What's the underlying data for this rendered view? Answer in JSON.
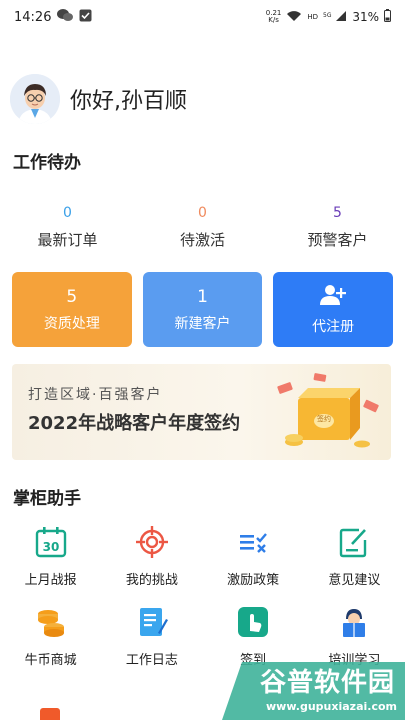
{
  "status_bar": {
    "time": "14:26",
    "net_speed_value": "0.21",
    "net_speed_unit": "K/s",
    "hd": "HD",
    "network": "5G",
    "battery": "31%"
  },
  "greeting": {
    "text": "你好,孙百顺"
  },
  "todo": {
    "title": "工作待办",
    "stats": [
      {
        "count": "0",
        "label": "最新订单",
        "color": "#3aa0e8"
      },
      {
        "count": "0",
        "label": "待激活",
        "color": "#f08a5d"
      },
      {
        "count": "5",
        "label": "预警客户",
        "color": "#6a3db8"
      }
    ],
    "actions": [
      {
        "count": "5",
        "label": "资质处理",
        "color": "#f5a23a"
      },
      {
        "count": "1",
        "label": "新建客户",
        "color": "#5a9cf0"
      },
      {
        "count": "",
        "label": "代注册",
        "color": "#2e7cf6"
      }
    ]
  },
  "banner": {
    "line1": "打造区域·百强客户",
    "line2": "2022年战略客户年度签约",
    "box_label": "签约"
  },
  "assistant": {
    "title": "掌柜助手",
    "tools": [
      {
        "label": "上月战报",
        "icon": "calendar-30-icon",
        "badge": "30"
      },
      {
        "label": "我的挑战",
        "icon": "target-icon"
      },
      {
        "label": "激励政策",
        "icon": "policy-list-icon"
      },
      {
        "label": "意见建议",
        "icon": "feedback-edit-icon"
      },
      {
        "label": "牛币商城",
        "icon": "coins-icon"
      },
      {
        "label": "工作日志",
        "icon": "notepad-icon"
      },
      {
        "label": "签到",
        "icon": "touch-hand-icon"
      },
      {
        "label": "培训学习",
        "icon": "reading-person-icon"
      }
    ]
  },
  "watermark": {
    "line1": "谷普软件园",
    "line2": "www.gupuxiazai.com"
  }
}
